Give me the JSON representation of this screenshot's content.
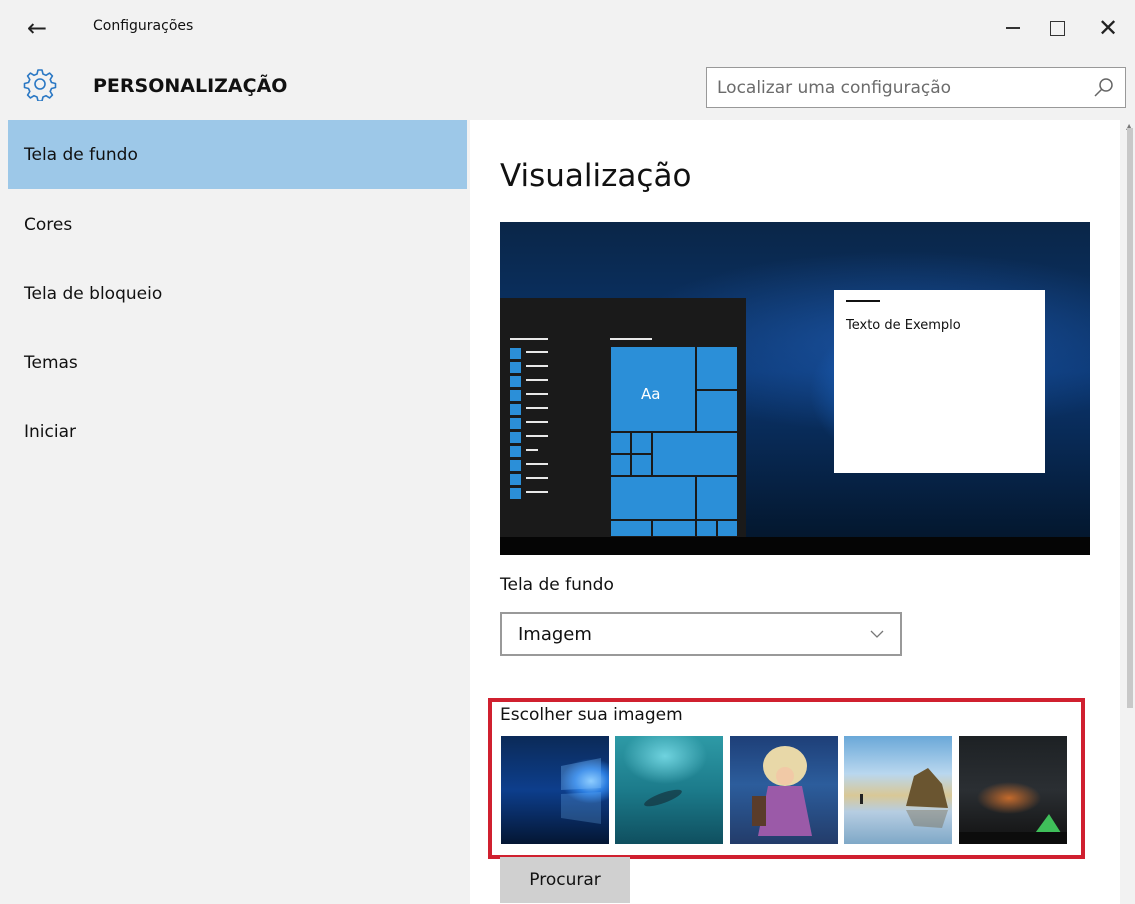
{
  "window": {
    "title": "Configurações",
    "back_icon": "←",
    "close_icon": "✕"
  },
  "header": {
    "section_title": "PERSONALIZAÇÃO",
    "search_placeholder": "Localizar uma configuração"
  },
  "sidebar": {
    "items": [
      {
        "label": "Tela de fundo",
        "active": true
      },
      {
        "label": "Cores",
        "active": false
      },
      {
        "label": "Tela de bloqueio",
        "active": false
      },
      {
        "label": "Temas",
        "active": false
      },
      {
        "label": "Iniciar",
        "active": false
      }
    ]
  },
  "main": {
    "preview_title": "Visualização",
    "preview": {
      "tile_label": "Aa",
      "sample_text": "Texto de Exemplo"
    },
    "background_label": "Tela de fundo",
    "background_value": "Imagem",
    "choose_label": "Escolher sua imagem",
    "browse_label": "Procurar"
  },
  "colors": {
    "accent": "#2b8fd8",
    "nav_active": "#9dc8e8",
    "highlight_border": "#d0202f"
  },
  "icons": {
    "gear": "gear-icon",
    "search": "search-icon",
    "chevron": "chevron-down-icon"
  }
}
